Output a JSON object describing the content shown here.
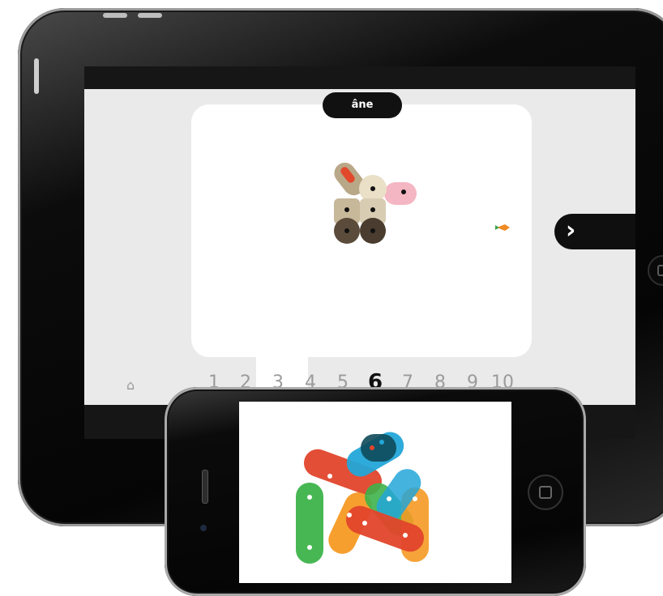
{
  "ipad": {
    "app": {
      "card_title": "âne",
      "next_symbol": "›",
      "home_symbol": "⌂",
      "page_numbers": [
        "1",
        "2",
        "3",
        "4",
        "5",
        "6",
        "7",
        "8",
        "9",
        "10"
      ],
      "current_page": "6"
    },
    "illustration": {
      "subject": "donkey",
      "colors": {
        "body": "#d8ccb3",
        "body_dark": "#c7b89a",
        "head": "#eadfc7",
        "ear": "#b9a888",
        "ear_inner": "#e2492c",
        "muzzle": "#f4b6c2",
        "feet": "#5b4b3a",
        "bolt": "#111111"
      },
      "carrot_colors": {
        "root": "#f08a24",
        "leaf": "#3ea34d"
      }
    }
  },
  "iphone": {
    "illustration": {
      "subject": "pile-of-pieces",
      "colors": [
        "#e2442b",
        "#23a6d8",
        "#3db34a",
        "#f59a23",
        "#0e4a5a"
      ]
    }
  },
  "theme": {
    "screen_bg": "#eaeaea",
    "card_bg": "#ffffff",
    "bar_bg": "#161616",
    "number_color": "#9b9b9b"
  }
}
